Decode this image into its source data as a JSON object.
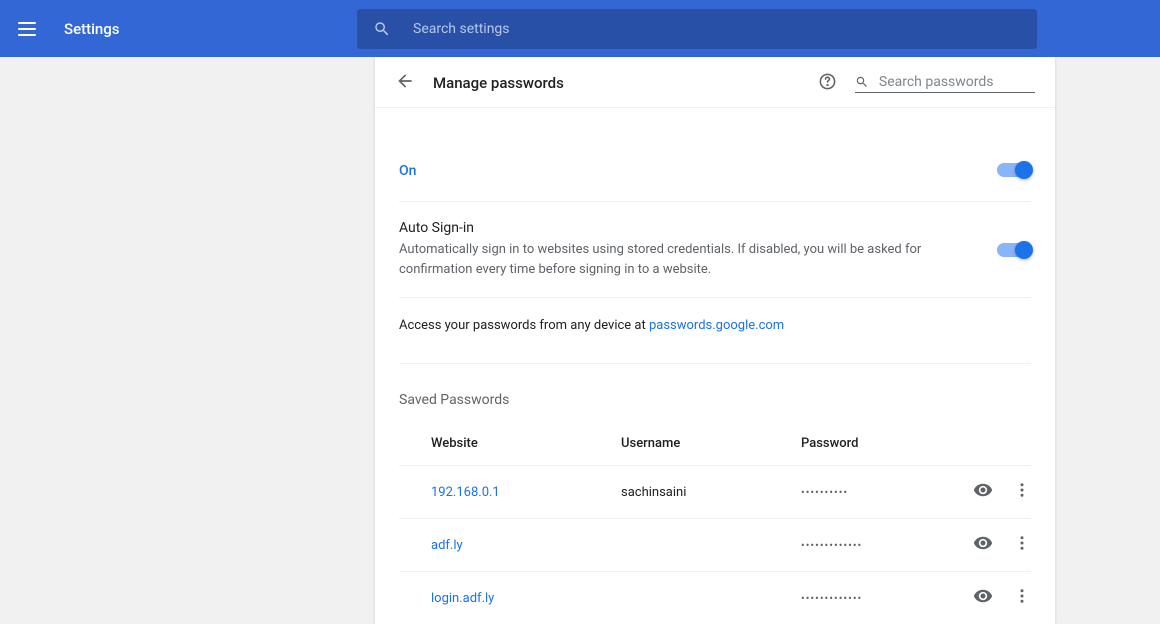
{
  "header": {
    "title": "Settings",
    "searchPlaceholder": "Search settings"
  },
  "page": {
    "title": "Manage passwords",
    "searchPlaceholder": "Search passwords"
  },
  "toggles": {
    "onLabel": "On",
    "autoSignin": {
      "title": "Auto Sign-in",
      "description": "Automatically sign in to websites using stored credentials. If disabled, you will be asked for confirmation every time before signing in to a website."
    }
  },
  "access": {
    "text": "Access your passwords from any device at ",
    "link": "passwords.google.com"
  },
  "saved": {
    "title": "Saved Passwords",
    "columns": {
      "website": "Website",
      "username": "Username",
      "password": "Password"
    },
    "rows": [
      {
        "website": "192.168.0.1",
        "username": "sachinsaini",
        "password": "••••••••••"
      },
      {
        "website": "adf.ly",
        "username": "",
        "password": "•••••••••••••"
      },
      {
        "website": "login.adf.ly",
        "username": "",
        "password": "•••••••••••••"
      }
    ]
  }
}
